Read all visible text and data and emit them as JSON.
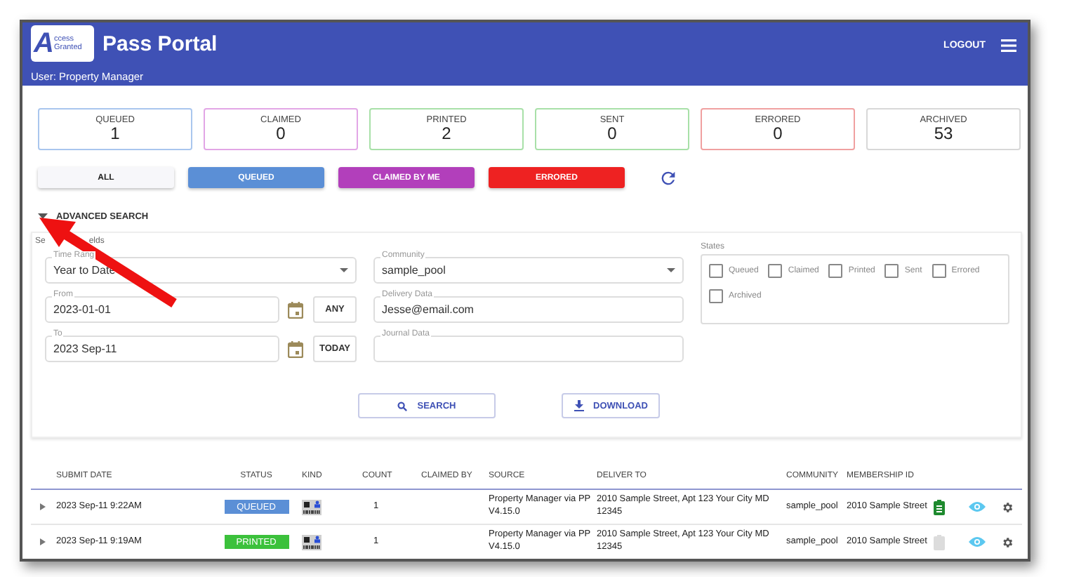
{
  "header": {
    "logo": {
      "initial": "A",
      "line1": "ccess",
      "line2": "Granted"
    },
    "title": "Pass Portal",
    "user": "User: Property Manager",
    "logout": "LOGOUT"
  },
  "status_cards": [
    {
      "label": "QUEUED",
      "count": "1",
      "color": "#a9c6ee"
    },
    {
      "label": "CLAIMED",
      "count": "0",
      "color": "#e2a6e6"
    },
    {
      "label": "PRINTED",
      "count": "2",
      "color": "#a8e0a8"
    },
    {
      "label": "SENT",
      "count": "0",
      "color": "#a8e0a8"
    },
    {
      "label": "ERRORED",
      "count": "0",
      "color": "#f0a0a0"
    },
    {
      "label": "ARCHIVED",
      "count": "53",
      "color": "#d8d8d8"
    }
  ],
  "filters": [
    {
      "label": "ALL",
      "color": "#f7f7fa"
    },
    {
      "label": "QUEUED",
      "color": "#5b8fd6"
    },
    {
      "label": "CLAIMED BY ME",
      "color": "#b23fbb"
    },
    {
      "label": "ERRORED",
      "color": "#ee2222"
    }
  ],
  "advanced_search": {
    "label": "ADVANCED SEARCH",
    "expanded": true,
    "legend_parts": [
      "Se",
      "elds"
    ],
    "time_range": {
      "label": "Time Rang",
      "value": "Year to Date"
    },
    "from": {
      "label": "From",
      "value": "2023-01-01",
      "button": "ANY"
    },
    "to": {
      "label": "To",
      "value": "2023 Sep-11",
      "button": "TODAY"
    },
    "community": {
      "label": "Community",
      "value": "sample_pool"
    },
    "delivery": {
      "label": "Delivery Data",
      "value": "Jesse@email.com"
    },
    "journal": {
      "label": "Journal Data"
    },
    "states": {
      "label": "States",
      "items": [
        {
          "label": "Queued",
          "checked": false
        },
        {
          "label": "Claimed",
          "checked": false
        },
        {
          "label": "Printed",
          "checked": false
        },
        {
          "label": "Sent",
          "checked": false
        },
        {
          "label": "Errored",
          "checked": false
        },
        {
          "label": "Archived",
          "checked": false
        }
      ]
    },
    "search_button": "SEARCH",
    "download_button": "DOWNLOAD"
  },
  "table": {
    "columns": [
      "SUBMIT DATE",
      "STATUS",
      "KIND",
      "COUNT",
      "CLAIMED BY",
      "SOURCE",
      "DELIVER TO",
      "COMMUNITY",
      "MEMBERSHIP ID"
    ],
    "rows": [
      {
        "submit_date": "2023 Sep-11 9:22AM",
        "status": "QUEUED",
        "color": "#5b8fd6",
        "count": "1",
        "source": "Property Manager via PP V4.15.0",
        "deliver_to": "2010 Sample Street, Apt 123 Your City MD 12345",
        "community": "sample_pool",
        "membership_id": "2010 Sample Street",
        "report_ready": true
      },
      {
        "submit_date": "2023 Sep-11 9:19AM",
        "status": "PRINTED",
        "color": "#3cc13c",
        "count": "1",
        "source": "Property Manager via PP V4.15.0",
        "deliver_to": "2010 Sample Street, Apt 123 Your City MD 12345",
        "community": "sample_pool",
        "membership_id": "2010 Sample Street",
        "report_ready": false
      }
    ]
  },
  "annotation": {
    "kind": "arrow"
  }
}
